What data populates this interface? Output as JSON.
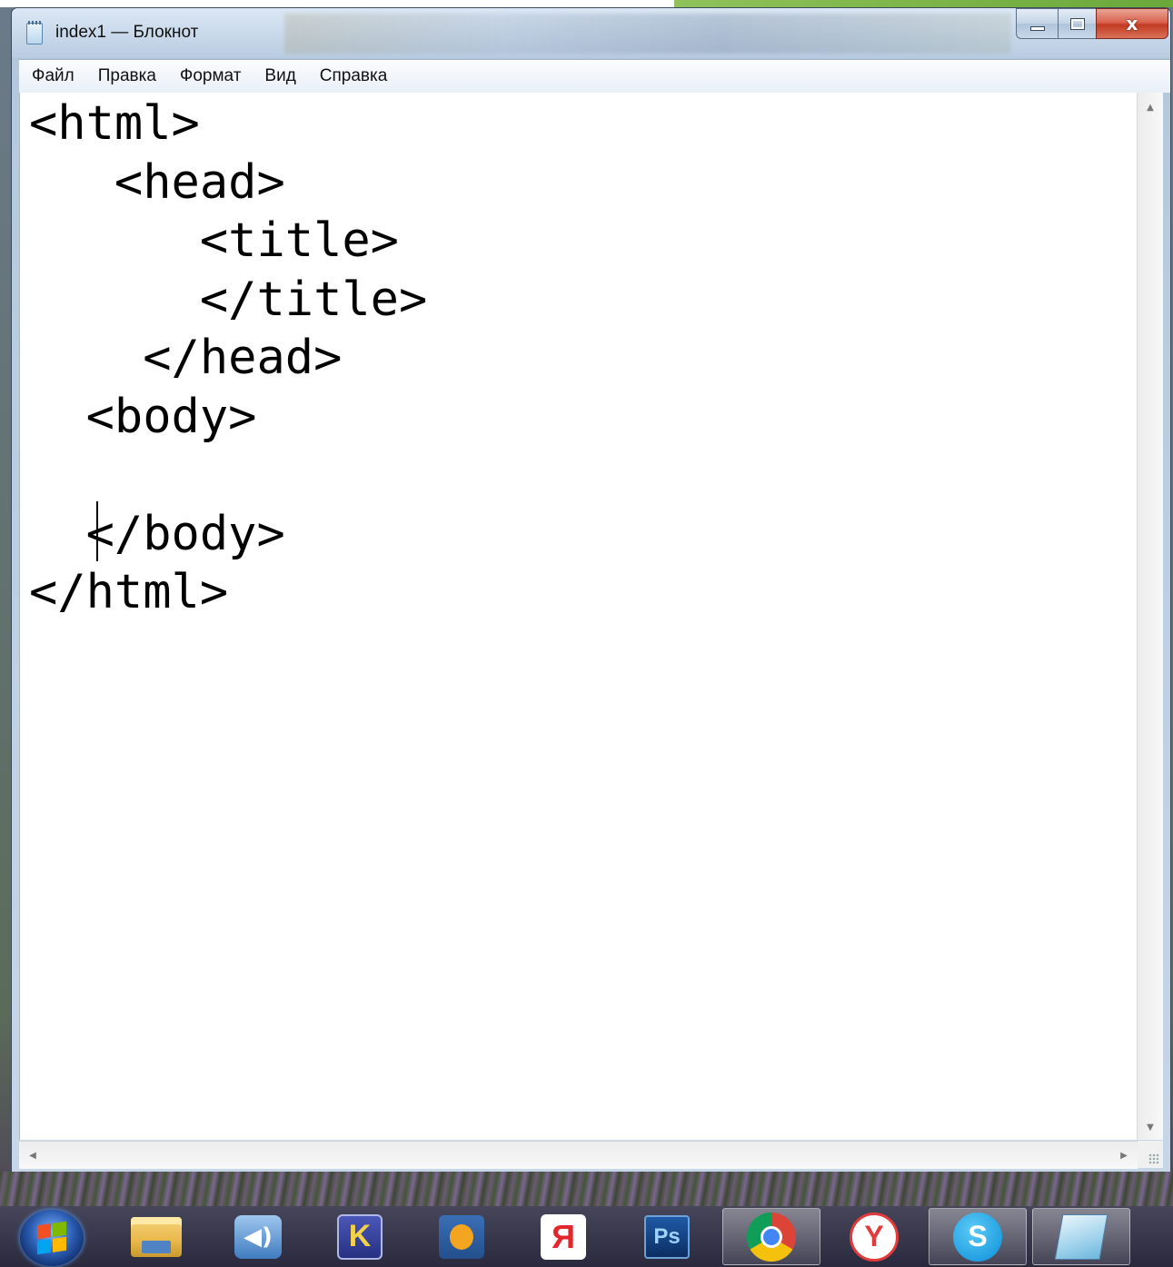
{
  "window": {
    "title": "index1 — Блокнот",
    "icon": "notepad-icon"
  },
  "title_controls": {
    "minimize_icon": "minimize-icon",
    "maximize_icon": "maximize-icon",
    "close_glyph": "x"
  },
  "menu": {
    "items": [
      {
        "label": "Файл"
      },
      {
        "label": "Правка"
      },
      {
        "label": "Формат"
      },
      {
        "label": "Вид"
      },
      {
        "label": "Справка"
      }
    ]
  },
  "editor": {
    "lines": [
      "<html>",
      "   <head>",
      "      <title>",
      "      </title>",
      "    </head>",
      "  <body>",
      "",
      "  </body>",
      "</html>"
    ],
    "caret_line": 8,
    "caret_column": 3
  },
  "scrollbars": {
    "up_arrow": "▲",
    "down_arrow": "▼",
    "left_arrow": "◀",
    "right_arrow": "▶"
  },
  "taskbar": {
    "start_icon": "windows-start-icon",
    "apps": [
      {
        "name": "explorer-icon",
        "glyph": ""
      },
      {
        "name": "speaker-app-icon",
        "glyph": "◀)"
      },
      {
        "name": "k-app-icon",
        "glyph": "K"
      },
      {
        "name": "media-player-icon",
        "glyph": ""
      },
      {
        "name": "yandex-icon",
        "glyph": "Я"
      },
      {
        "name": "photoshop-icon",
        "glyph": "Ps"
      },
      {
        "name": "chrome-icon",
        "glyph": ""
      },
      {
        "name": "yandex-browser-icon",
        "glyph": "Y"
      },
      {
        "name": "skype-icon",
        "glyph": "S"
      },
      {
        "name": "notepad-taskbar-icon",
        "glyph": ""
      }
    ]
  }
}
